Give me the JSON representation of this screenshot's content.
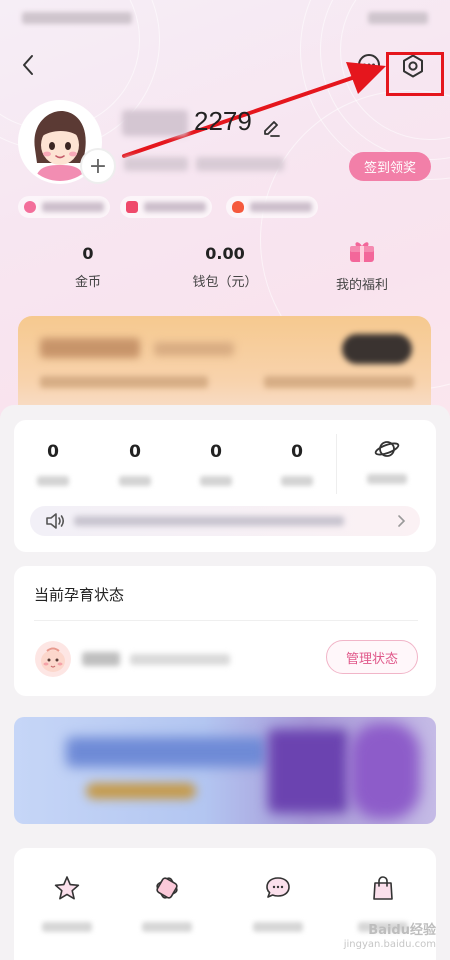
{
  "profile": {
    "user_id": "2279",
    "checkin_label": "签到领奖"
  },
  "stats": [
    {
      "value": "0",
      "label": "金币"
    },
    {
      "value": "0.00",
      "label": "钱包（元）"
    },
    {
      "label": "我的福利"
    }
  ],
  "counters": [
    {
      "value": "0"
    },
    {
      "value": "0"
    },
    {
      "value": "0"
    },
    {
      "value": "0"
    }
  ],
  "pregnancy": {
    "title": "当前孕育状态",
    "manage_label": "管理状态"
  },
  "watermark": {
    "line1": "Baidu经验",
    "line2": "jingyan.baidu.com"
  },
  "colors": {
    "accent_pink": "#f27fa8",
    "highlight_red": "#e5161d"
  },
  "icons": [
    "back-icon",
    "message-icon",
    "settings-icon",
    "edit-icon",
    "gift-icon",
    "speaker-icon",
    "planet-icon",
    "star-icon",
    "ticket-icon",
    "chat-icon",
    "bag-icon"
  ]
}
